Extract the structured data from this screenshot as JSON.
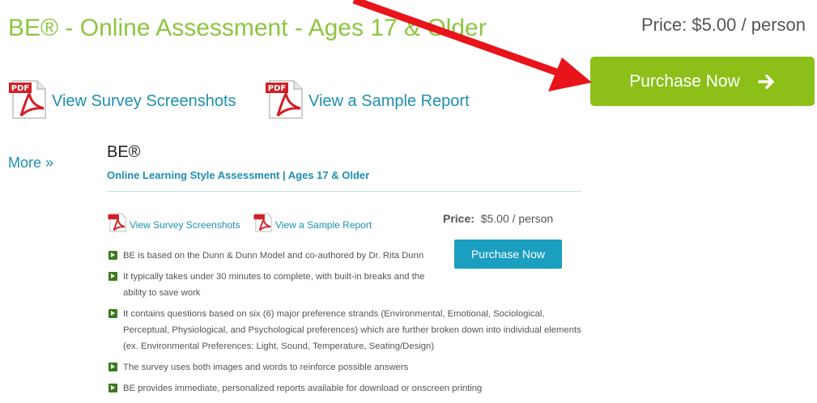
{
  "top": {
    "title": "BE® - Online Assessment - Ages 17 & Older",
    "price": "Price: $5.00 / person",
    "purchase_label": "Purchase Now",
    "links": [
      {
        "label": "View Survey Screenshots",
        "icon": "pdf-icon"
      },
      {
        "label": "View a Sample Report",
        "icon": "pdf-icon"
      }
    ]
  },
  "card": {
    "more_label": "More »",
    "name": "BE®",
    "subtitle": "Online Learning Style Assessment | Ages 17 & Older",
    "links": [
      {
        "label": "View Survey Screenshots",
        "icon": "pdf-icon"
      },
      {
        "label": "View a Sample Report",
        "icon": "pdf-icon"
      }
    ],
    "price_label": "Price:",
    "price_value": "$5.00 / person",
    "purchase_label": "Purchase Now",
    "bullets": [
      "BE is based on the Dunn & Dunn Model and co-authored by Dr. Rita Dunn",
      "It typically takes under 30 minutes to complete, with built-in breaks and the ability to save work",
      "It contains questions based on six (6) major preference strands (Environmental, Emotional, Sociological, Perceptual, Physiological, and Psychological preferences) which are further broken down into individual elements (ex. Environmental Preferences: Light, Sound, Temperature, Seating/Design)",
      "The survey uses both images and words to reinforce possible answers",
      "BE provides immediate, personalized reports available for download or onscreen printing"
    ]
  },
  "colors": {
    "green_title": "#8cc63f",
    "green_button": "#8cc019",
    "link_blue": "#1e8fb0",
    "blue_button": "#1a9fc0",
    "annotation_red": "#e8141a"
  }
}
